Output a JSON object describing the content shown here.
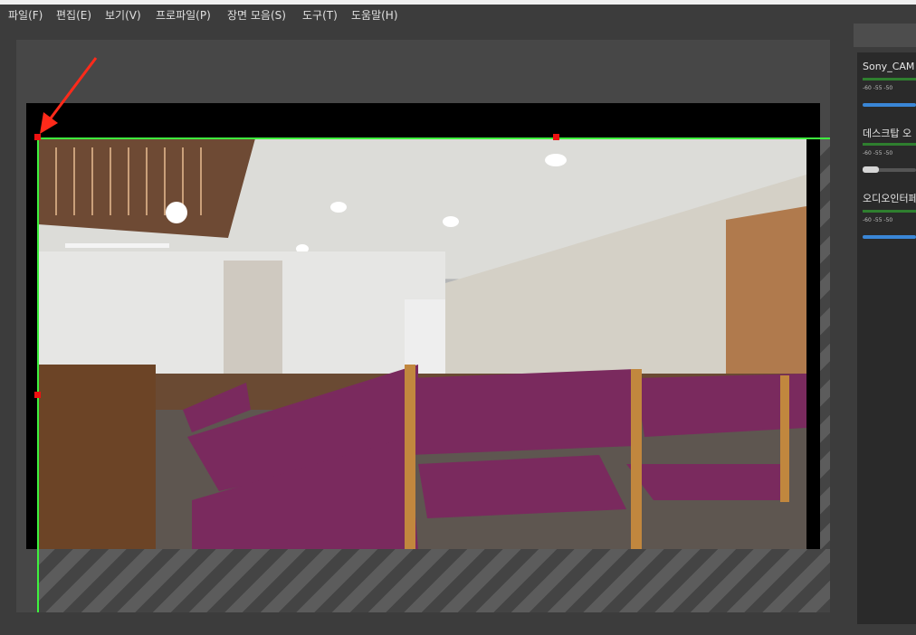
{
  "menu": {
    "items": [
      {
        "label": "파일(F)"
      },
      {
        "label": "편집(E)"
      },
      {
        "label": "보기(V)"
      },
      {
        "label": "프로파일(P)"
      },
      {
        "label": "장면 모음(S)"
      },
      {
        "label": "도구(T)"
      },
      {
        "label": "도움말(H)"
      }
    ]
  },
  "audio_mixer": {
    "sources": [
      {
        "name": "Sony_CAM",
        "ticks": "-60   -55   -50",
        "volume_fraction": 1.0
      },
      {
        "name": "데스크탑 오",
        "ticks": "-60   -55   -50",
        "volume_fraction": 0.0
      },
      {
        "name": "오디오인터페",
        "ticks": "-60   -55   -50",
        "volume_fraction": 1.0
      }
    ]
  },
  "colors": {
    "selection_outline": "#3ef23e",
    "handle": "#e11111",
    "annotation_arrow": "#ff2a1a",
    "volume_fill": "#3a86d6"
  }
}
